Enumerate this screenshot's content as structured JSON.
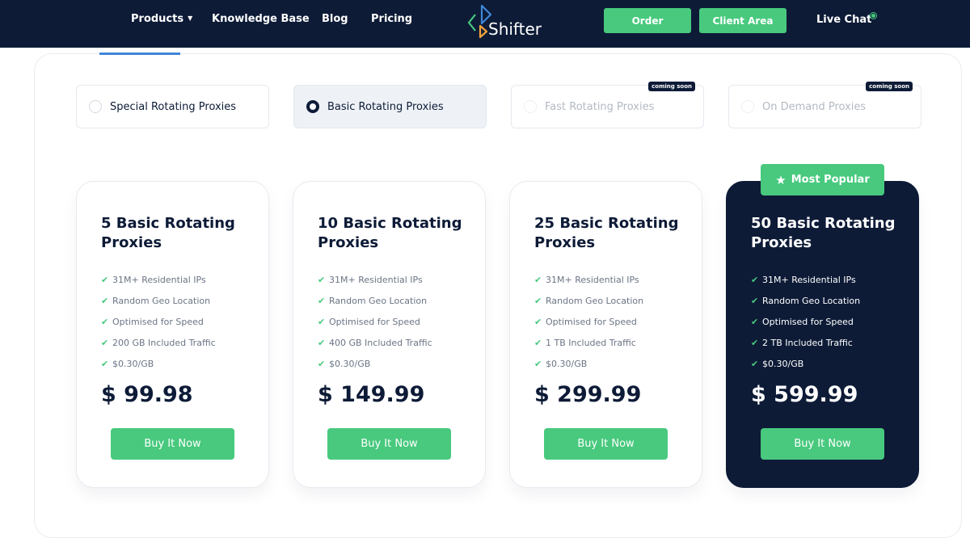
{
  "nav": {
    "products": "Products",
    "knowledge_base": "Knowledge Base",
    "blog": "Blog",
    "pricing": "Pricing",
    "logo_text": "Shifter",
    "order": "Order",
    "client_area": "Client Area",
    "live_chat": "Live Chat",
    "products_caret_icon": "caret-down-icon",
    "live_chat_status_icon": "online-dot-icon"
  },
  "proxy_types": [
    {
      "label": "Special Rotating Proxies",
      "selected": false,
      "badge": ""
    },
    {
      "label": "Basic Rotating Proxies",
      "selected": true,
      "badge": ""
    },
    {
      "label": "Fast Rotating Proxies",
      "selected": false,
      "badge": "coming soon"
    },
    {
      "label": "On Demand Proxies",
      "selected": false,
      "badge": "coming soon"
    }
  ],
  "popular_badge": {
    "label": "Most Popular",
    "icon": "star-icon"
  },
  "check_icon": "check-icon",
  "plans": [
    {
      "title": "5 Basic Rotating Proxies",
      "features": [
        "31M+ Residential IPs",
        "Random Geo Location",
        "Optimised for Speed",
        "200 GB Included Traffic",
        "$0.30/GB"
      ],
      "price": "$ 99.98",
      "button": "Buy It Now"
    },
    {
      "title": "10 Basic Rotating Proxies",
      "features": [
        "31M+ Residential IPs",
        "Random Geo Location",
        "Optimised for Speed",
        "400 GB Included Traffic",
        "$0.30/GB"
      ],
      "price": "$ 149.99",
      "button": "Buy It Now"
    },
    {
      "title": "25 Basic Rotating Proxies",
      "features": [
        "31M+ Residential IPs",
        "Random Geo Location",
        "Optimised for Speed",
        "1 TB Included Traffic",
        "$0.30/GB"
      ],
      "price": "$ 299.99",
      "button": "Buy It Now"
    },
    {
      "title": "50 Basic Rotating Proxies",
      "features": [
        "31M+ Residential IPs",
        "Random Geo Location",
        "Optimised for Speed",
        "2 TB Included Traffic",
        "$0.30/GB"
      ],
      "price": "$ 599.99",
      "button": "Buy It Now"
    }
  ],
  "colors": {
    "navy": "#0d1b37",
    "green": "#48c97e",
    "tab_underline": "#3f86d8",
    "selected_option_bg": "#eef2f7",
    "feature_text": "#6b7585"
  }
}
